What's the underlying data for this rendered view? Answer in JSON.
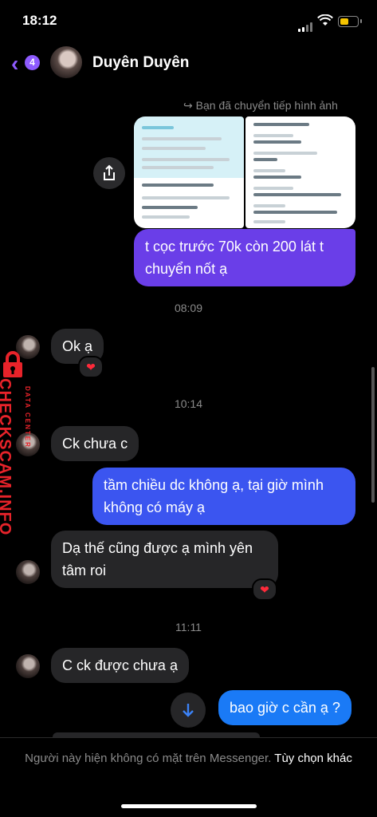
{
  "status_bar": {
    "time": "18:12"
  },
  "header": {
    "back_count": "4",
    "contact_name": "Duyên Duyên"
  },
  "forward_note": "Bạn đã chuyển tiếp hình ảnh",
  "messages": {
    "out1": "t cọc trước 70k còn 200 lát t chuyển nốt ạ",
    "stamp1": "08:09",
    "in1": "Ok ạ",
    "stamp2": "10:14",
    "in2": "Ck chưa c",
    "out2": "tầm chiều dc không ạ, tại giờ mình không có máy ạ",
    "in3": "Dạ thế cũng được ạ mình yên tâm roi",
    "stamp3": "11:11",
    "in4": "C ck được chưa ạ",
    "out3": "bao giờ c cần ạ ?"
  },
  "reaction_icon": "heart-icon",
  "footer": {
    "notice": "Người này hiện không có mặt trên Messenger.",
    "action": "Tùy chọn khác"
  },
  "watermark": {
    "text": "CHECKSCAM.INFO",
    "sub": "DATA CENTER"
  },
  "colors": {
    "accent": "#8e5bff",
    "bubble_purple": "#6a3ee8",
    "bubble_blue": "#3b55f0",
    "bubble_lightblue": "#1a7af6",
    "incoming": "#262628",
    "watermark": "#e8232a"
  }
}
